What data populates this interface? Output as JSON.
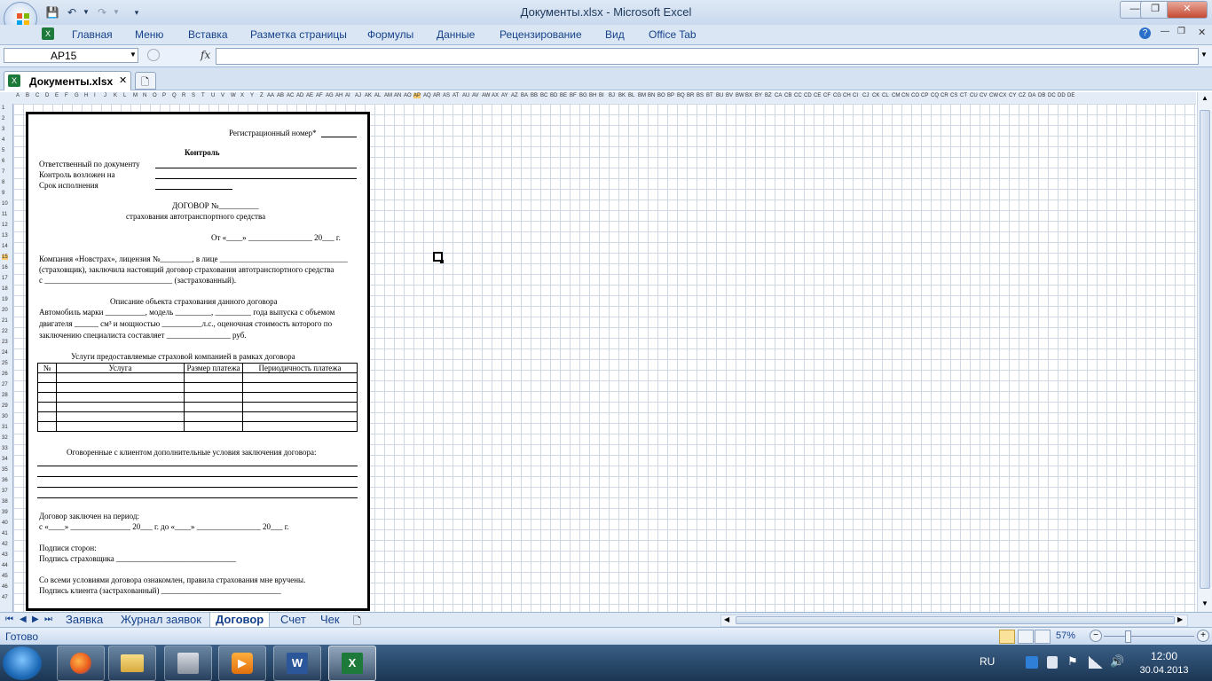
{
  "window": {
    "title": "Документы.xlsx - Microsoft Excel"
  },
  "ribbon_tabs": [
    "Главная",
    "Меню",
    "Вставка",
    "Разметка страницы",
    "Формулы",
    "Данные",
    "Рецензирование",
    "Вид",
    "Office Tab"
  ],
  "formula_bar": {
    "name_box": "AP15",
    "fx_label": "fx",
    "formula": ""
  },
  "doc_tab": {
    "label": "Документы.xlsx"
  },
  "columns": [
    "A",
    "B",
    "C",
    "D",
    "E",
    "F",
    "G",
    "H",
    "I",
    "J",
    "K",
    "L",
    "M",
    "N",
    "O",
    "P",
    "Q",
    "R",
    "S",
    "T",
    "U",
    "V",
    "W",
    "X",
    "Y",
    "Z",
    "AA",
    "AB",
    "AC",
    "AD",
    "AE",
    "AF",
    "AG",
    "AH",
    "AI",
    "AJ",
    "AK",
    "AL",
    "AM",
    "AN",
    "AO",
    "AP",
    "AQ",
    "AR",
    "AS",
    "AT",
    "AU",
    "AV",
    "AW",
    "AX",
    "AY",
    "AZ",
    "BA",
    "BB",
    "BC",
    "BD",
    "BE",
    "BF",
    "BG",
    "BH",
    "BI",
    "BJ",
    "BK",
    "BL",
    "BM",
    "BN",
    "BO",
    "BP",
    "BQ",
    "BR",
    "BS",
    "BT",
    "BU",
    "BV",
    "BW",
    "BX",
    "BY",
    "BZ",
    "CA",
    "CB",
    "CC",
    "CD",
    "CE",
    "CF",
    "CG",
    "CH",
    "CI",
    "CJ",
    "CK",
    "CL",
    "CM",
    "CN",
    "CO",
    "CP",
    "CQ",
    "CR",
    "CS",
    "CT",
    "CU",
    "CV",
    "CW",
    "CX",
    "CY",
    "CZ",
    "DA",
    "DB",
    "DC",
    "DD",
    "DE"
  ],
  "form": {
    "reg_number": "Регистрационный номер*",
    "control_header": "Контроль",
    "responsible": "Ответственный по документу",
    "control_by": "Контроль возложен на",
    "deadline": "Срок исполнения",
    "contract_no": "ДОГОВОР №__________",
    "contract_subject": "страхования автотранспортного средства",
    "date_line": "От «____» ________________ 20___ г.",
    "company_line1": "Компания «Новстрах», лицензия №________, в лице ________________________________",
    "company_line2": "(страховщик), заключила настоящий договор страхования автотранспортного средства",
    "company_line3": "с ________________________________ (застрахованный).",
    "object_title": "Описание объекта страхования данного договора",
    "object_line1": "Автомобиль марки __________, модель _________, _________ года выпуска с объемом",
    "object_line2": "двигателя ______ см³ и мощностью __________л.с., оценочная стоимость которого по",
    "object_line3": "заключению специалиста составляет ________________ руб.",
    "services_title": "Услуги предоставляемые страховой компанией в рамках договора",
    "services_headers": [
      "№",
      "Услуга",
      "Размер платежа",
      "Периодичность платежа"
    ],
    "extra_title": "Оговоренные с клиентом дополнительные условия заключения договора:",
    "period_title": "Договор заключен на период:",
    "period_line": "с «____» _______________ 20___ г. до «____» ________________ 20___ г.",
    "signatures_title": "Подписи сторон:",
    "insurer_sign": "Подпись страховщика ______________________________",
    "acknowledge": "Со всеми условиями договора ознакомлен, правила страхования мне вручены.",
    "client_sign": "Подпись клиента (застрахованный) ______________________________"
  },
  "sheet_tabs": [
    "Заявка",
    "Журнал заявок",
    "Договор",
    "Счет",
    "Чек"
  ],
  "active_sheet": "Договор",
  "status": {
    "ready": "Готово",
    "zoom": "57%"
  },
  "taskbar": {
    "lang": "RU",
    "time": "12:00",
    "date": "30.04.2013"
  }
}
